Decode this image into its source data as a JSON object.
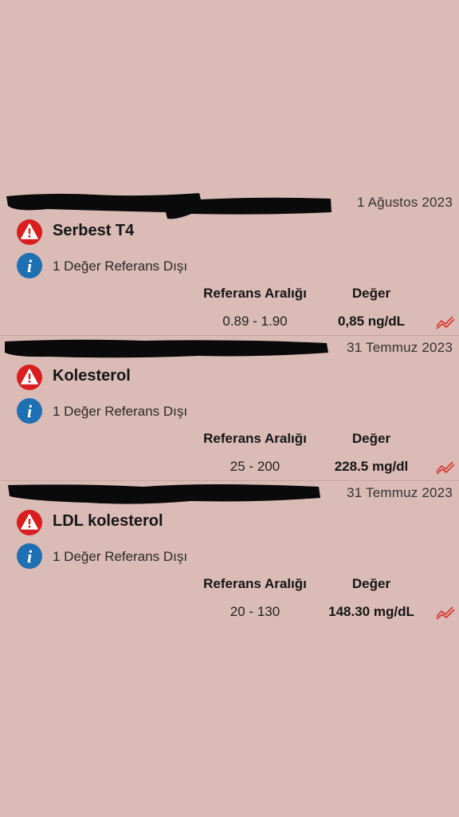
{
  "results": [
    {
      "date": "1 Ağustos 2023",
      "test_name": "Serbest T4",
      "info_text": "1 Değer Referans Dışı",
      "ref_header": "Referans Aralığı",
      "value_header": "Değer",
      "reference_range": "0.89 - 1.90",
      "value": "0,85 ng/dL"
    },
    {
      "date": "31 Temmuz 2023",
      "test_name": "Kolesterol",
      "info_text": "1 Değer Referans Dışı",
      "ref_header": "Referans Aralığı",
      "value_header": "Değer",
      "reference_range": "25 - 200",
      "value": "228.5 mg/dl"
    },
    {
      "date": "31 Temmuz 2023",
      "test_name": "LDL kolesterol",
      "info_text": "1 Değer Referans Dışı",
      "ref_header": "Referans Aralığı",
      "value_header": "Değer",
      "reference_range": "20 - 130",
      "value": "148.30 mg/dL"
    }
  ],
  "colors": {
    "background": "#dbbbb6",
    "warning_red": "#d81e1e",
    "info_blue": "#1f6fb3",
    "trend_red": "#d8322d",
    "redaction": "#0a0a0a"
  },
  "icons": {
    "warning": "warning-triangle-icon",
    "info": "info-icon",
    "trend": "trend-chart-icon"
  }
}
